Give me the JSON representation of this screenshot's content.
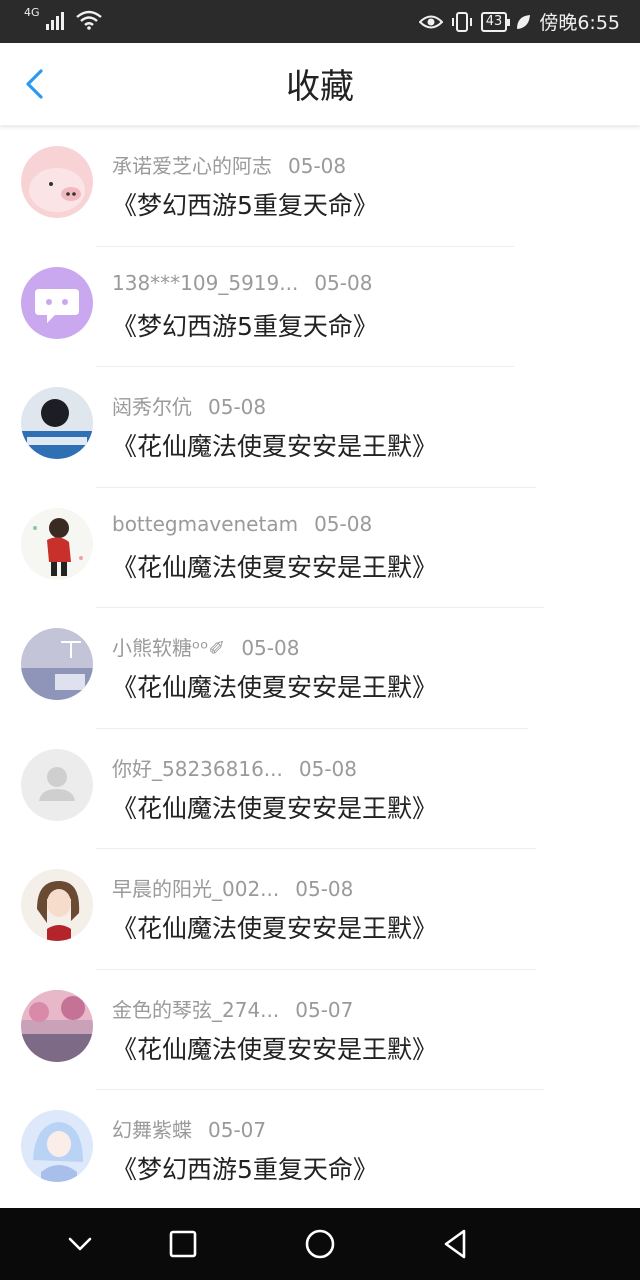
{
  "status_bar": {
    "network": "4G",
    "battery": "43",
    "time": "傍晚6:55"
  },
  "header": {
    "title": "收藏"
  },
  "items": [
    {
      "user": "承诺爱芝心的阿志",
      "date": "05-08",
      "book": "《梦幻西游5重复天命》"
    },
    {
      "user": "138***109_5919...",
      "date": "05-08",
      "book": "《梦幻西游5重复天命》"
    },
    {
      "user": "闼秀尔伉",
      "date": "05-08",
      "book": "《花仙魔法使夏安安是王默》"
    },
    {
      "user": "bottegmavenetam",
      "date": "05-08",
      "book": "《花仙魔法使夏安安是王默》"
    },
    {
      "user": "小熊软糖ᵒᵒ✐",
      "date": "05-08",
      "book": "《花仙魔法使夏安安是王默》"
    },
    {
      "user": "你好_58236816...",
      "date": "05-08",
      "book": "《花仙魔法使夏安安是王默》"
    },
    {
      "user": "早晨的阳光_002...",
      "date": "05-08",
      "book": "《花仙魔法使夏安安是王默》"
    },
    {
      "user": "金色的琴弦_274...",
      "date": "05-07",
      "book": "《花仙魔法使夏安安是王默》"
    },
    {
      "user": "幻舞紫蝶",
      "date": "05-07",
      "book": "《梦幻西游5重复天命》"
    }
  ],
  "colors": {
    "accent": "#2b9af3",
    "status_bar_bg": "#2b2b2b",
    "nav_bar_bg": "#0a0a0a"
  }
}
